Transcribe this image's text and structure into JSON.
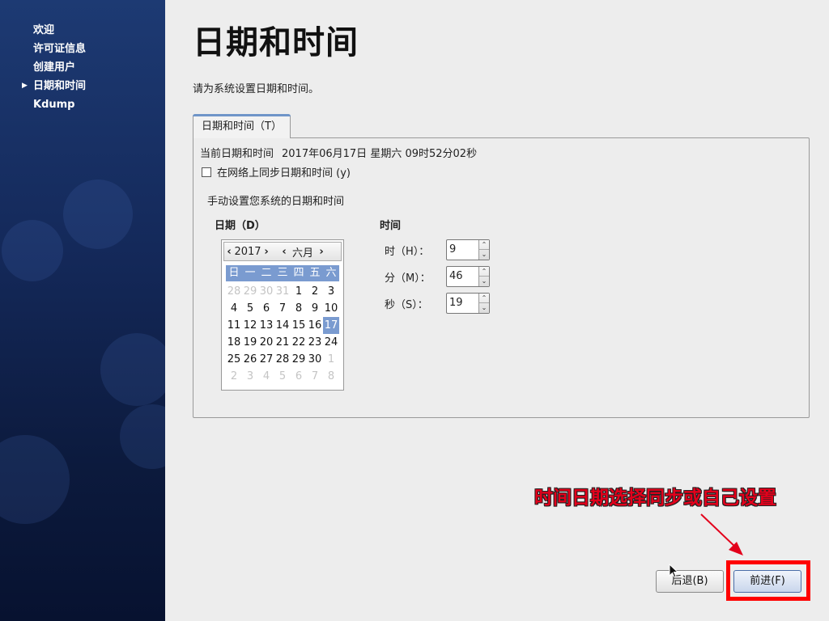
{
  "sidebar": {
    "items": [
      {
        "label": "欢迎",
        "current": false
      },
      {
        "label": "许可证信息",
        "current": false
      },
      {
        "label": "创建用户",
        "current": false
      },
      {
        "label": "日期和时间",
        "current": true
      },
      {
        "label": "Kdump",
        "current": false
      }
    ],
    "current_marker_icon": "caret-right-icon"
  },
  "page": {
    "title": "日期和时间",
    "intro": "请为系统设置日期和时间。"
  },
  "tab": {
    "label": "日期和时间（T）"
  },
  "current": {
    "label": "当前日期和时间",
    "value": "2017年06月17日 星期六 09时52分02秒"
  },
  "sync": {
    "label": "在网络上同步日期和时间 (y)",
    "checked": false
  },
  "manual": {
    "label": "手动设置您系统的日期和时间"
  },
  "date": {
    "label": "日期（D）"
  },
  "calendar": {
    "year": "2017",
    "month": "六月",
    "weekdays": [
      "日",
      "一",
      "二",
      "三",
      "四",
      "五",
      "六"
    ],
    "selected_day": "17",
    "weeks": [
      [
        {
          "d": "28",
          "o": true
        },
        {
          "d": "29",
          "o": true
        },
        {
          "d": "30",
          "o": true
        },
        {
          "d": "31",
          "o": true
        },
        {
          "d": "1"
        },
        {
          "d": "2"
        },
        {
          "d": "3"
        }
      ],
      [
        {
          "d": "4"
        },
        {
          "d": "5"
        },
        {
          "d": "6"
        },
        {
          "d": "7"
        },
        {
          "d": "8"
        },
        {
          "d": "9"
        },
        {
          "d": "10"
        }
      ],
      [
        {
          "d": "11"
        },
        {
          "d": "12"
        },
        {
          "d": "13"
        },
        {
          "d": "14"
        },
        {
          "d": "15"
        },
        {
          "d": "16"
        },
        {
          "d": "17",
          "s": true
        }
      ],
      [
        {
          "d": "18"
        },
        {
          "d": "19"
        },
        {
          "d": "20"
        },
        {
          "d": "21"
        },
        {
          "d": "22"
        },
        {
          "d": "23"
        },
        {
          "d": "24"
        }
      ],
      [
        {
          "d": "25"
        },
        {
          "d": "26"
        },
        {
          "d": "27"
        },
        {
          "d": "28"
        },
        {
          "d": "29"
        },
        {
          "d": "30"
        },
        {
          "d": "1",
          "o": true
        }
      ],
      [
        {
          "d": "2",
          "o": true
        },
        {
          "d": "3",
          "o": true
        },
        {
          "d": "4",
          "o": true
        },
        {
          "d": "5",
          "o": true
        },
        {
          "d": "6",
          "o": true
        },
        {
          "d": "7",
          "o": true
        },
        {
          "d": "8",
          "o": true
        }
      ]
    ],
    "selection_color": "#7a9bd0"
  },
  "time": {
    "label": "时间",
    "hour_label": "时（H）：",
    "hour": "9",
    "minute_label": "分（M）：",
    "minute": "46",
    "second_label": "秒（S）：",
    "second": "19"
  },
  "annotation": {
    "text": "时间日期选择同步或自己设置",
    "color": "#e3001b"
  },
  "buttons": {
    "back": "后退(B)",
    "next": "前进(F)"
  },
  "highlight_color": "#ff0000"
}
